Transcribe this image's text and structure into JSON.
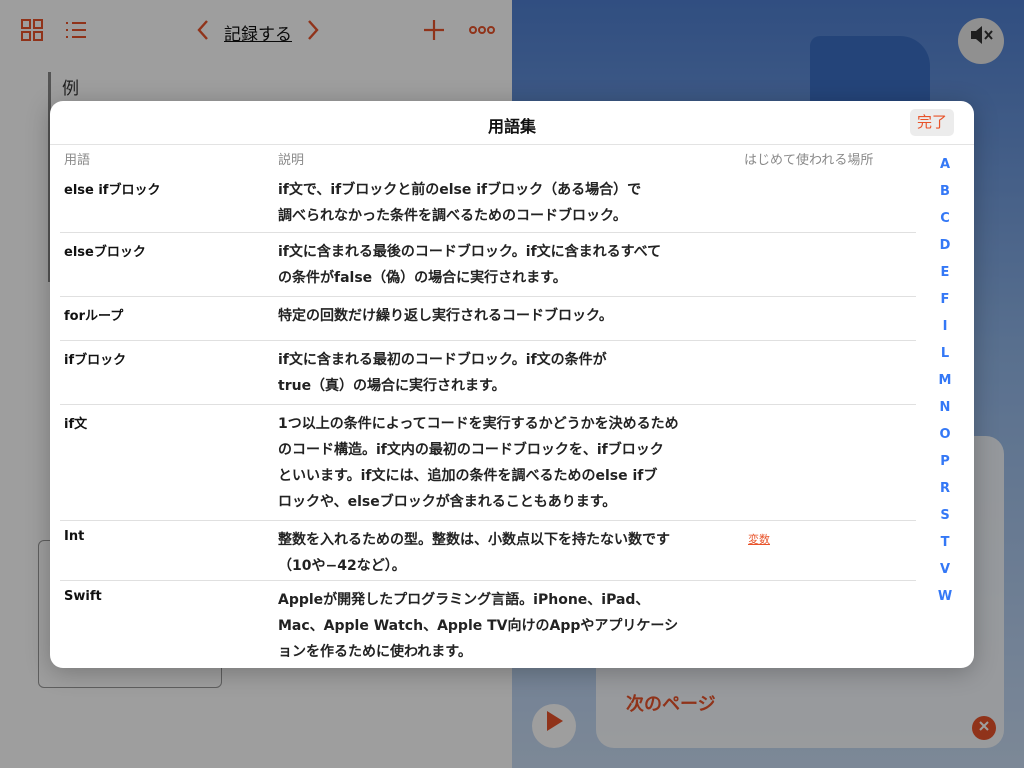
{
  "background": {
    "toolbar_title": "記録する",
    "heading": "例",
    "next_page": "次のページ",
    "icons": [
      "grid-icon",
      "list-icon",
      "chevron-left-icon",
      "chevron-right-icon",
      "plus-icon",
      "more-icon",
      "speaker-muted-icon",
      "play-icon",
      "close-icon"
    ],
    "accent_color": "#e8532a"
  },
  "glossary": {
    "title": "用語集",
    "done_label": "完了",
    "columns": [
      "用語",
      "説明",
      "はじめて使われる場所"
    ],
    "rows": [
      {
        "term": "else ifブロック",
        "description": "if文で、ifブロックと前のelse ifブロック（ある場合）で\n調べられなかった条件を調べるためのコードブロック。",
        "used_in": ""
      },
      {
        "term": "elseブロック",
        "description": "if文に含まれる最後のコードブロック。if文に含まれるすべて\nの条件がfalse（偽）の場合に実行されます。",
        "used_in": ""
      },
      {
        "term": "forループ",
        "description": "特定の回数だけ繰り返し実行されるコードブロック。",
        "used_in": ""
      },
      {
        "term": "ifブロック",
        "description": "if文に含まれる最初のコードブロック。if文の条件が\ntrue（真）の場合に実行されます。",
        "used_in": ""
      },
      {
        "term": "if文",
        "description": "1つ以上の条件によってコードを実行するかどうかを決めるため\nのコード構造。if文内の最初のコードブロックを、ifブロック\nといいます。if文には、追加の条件を調べるためのelse ifブ\nロックや、elseブロックが含まれることもあります。",
        "used_in": ""
      },
      {
        "term": "Int",
        "description": "整数を入れるための型。整数は、小数点以下を持たない数です\n（10や−42など）。",
        "used_in": "変数"
      },
      {
        "term": "Swift",
        "description": "Appleが開発したプログラミング言語。iPhone、iPad、\nMac、Apple Watch、Apple TV向けのAppやアプリケーシ\nョンを作るために使われます。",
        "used_in": ""
      }
    ],
    "index_letters": [
      "A",
      "B",
      "C",
      "D",
      "E",
      "F",
      "I",
      "L",
      "M",
      "N",
      "O",
      "P",
      "R",
      "S",
      "T",
      "V",
      "W"
    ]
  }
}
